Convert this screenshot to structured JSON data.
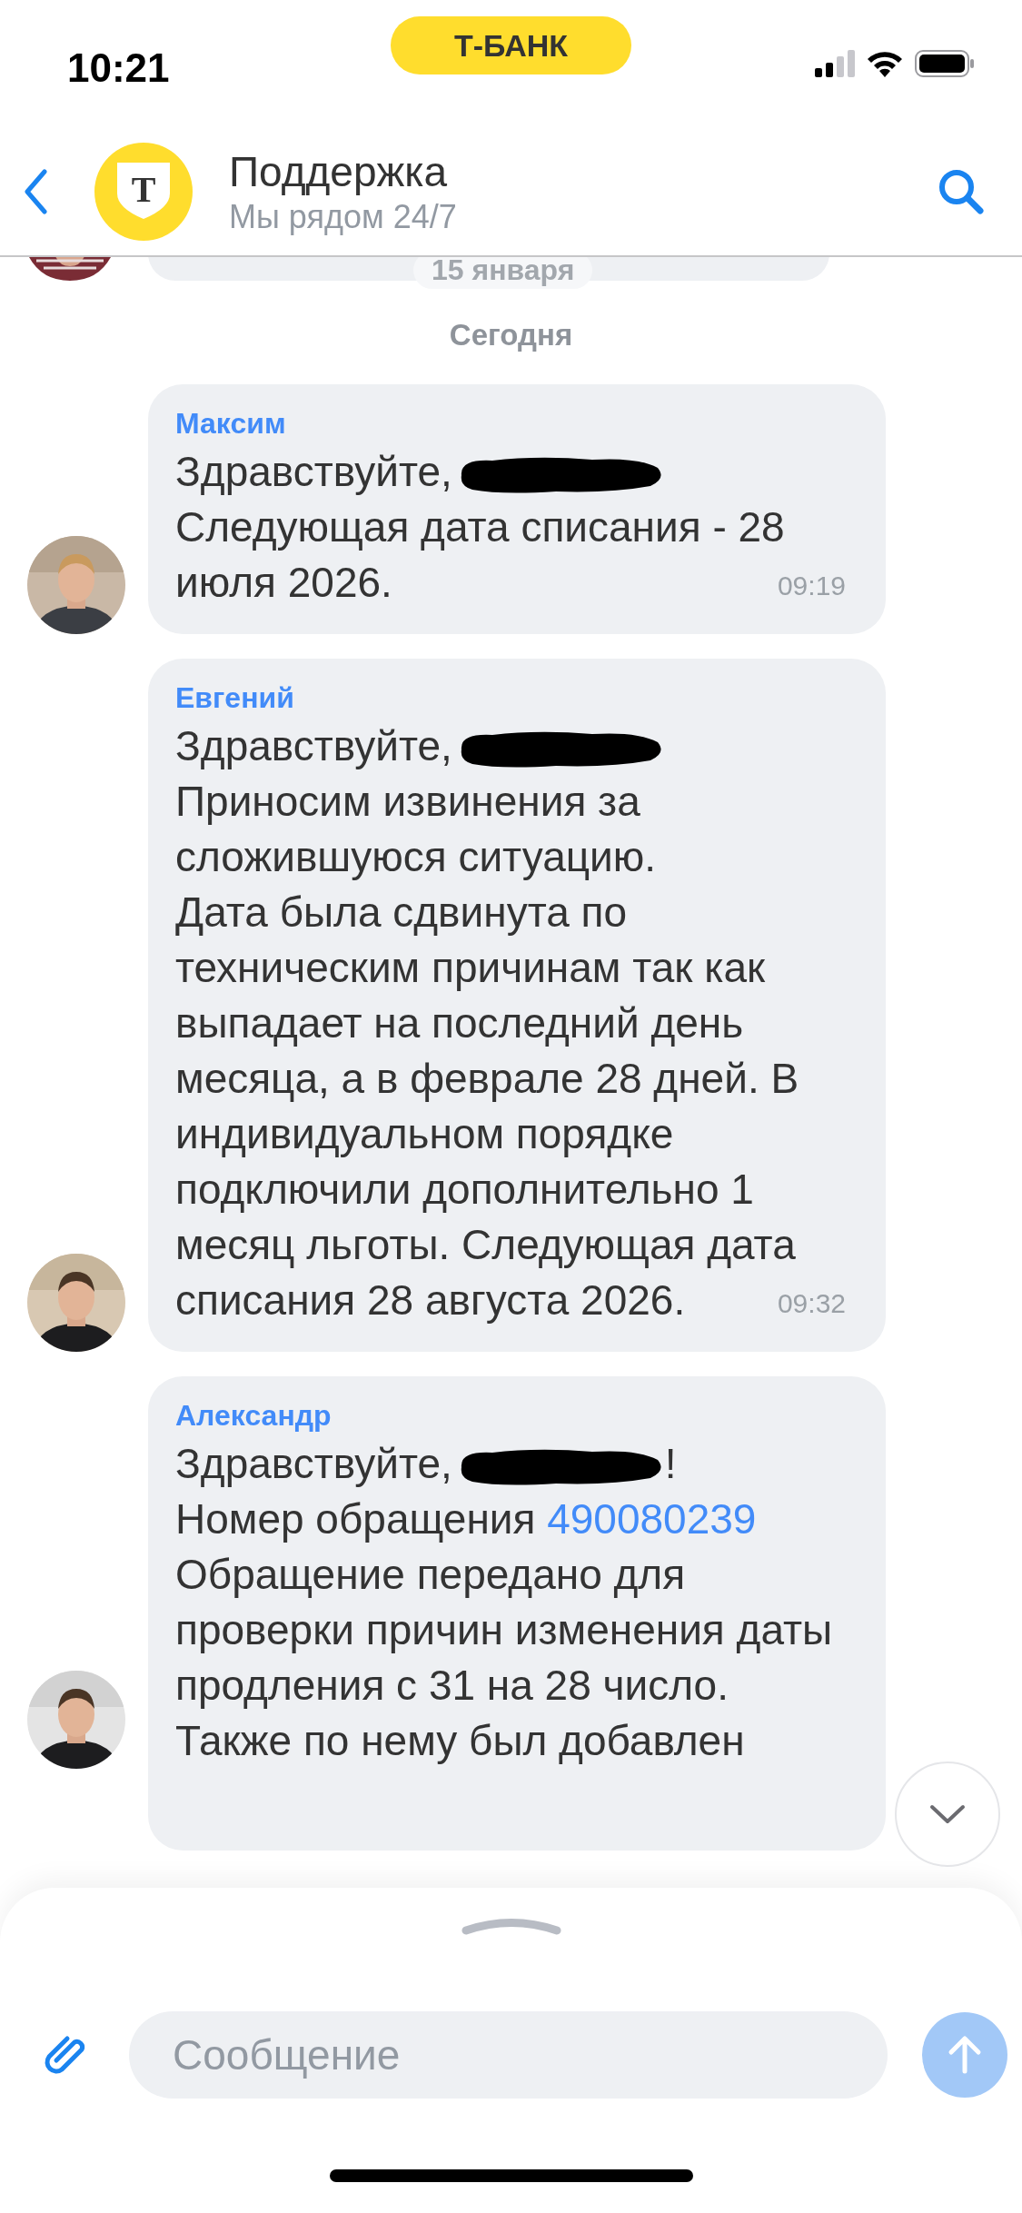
{
  "status_bar": {
    "time": "10:21",
    "brand_pill": "Т-БАНК"
  },
  "header": {
    "logo_letter": "Т",
    "title": "Поддержка",
    "subtitle": "Мы рядом 24/7"
  },
  "previous": {
    "date_chip": "15 января"
  },
  "day_separator": "Сегодня",
  "messages": [
    {
      "author": "Максим",
      "time": "09:19",
      "paragraphs": [
        [
          {
            "kind": "text",
            "text": "Здравствуйте,"
          },
          {
            "kind": "redacted"
          }
        ],
        [
          {
            "kind": "text",
            "text": "Следующая дата списания - 28 июля 2026."
          }
        ]
      ]
    },
    {
      "author": "Евгений",
      "time": "09:32",
      "paragraphs": [
        [
          {
            "kind": "text",
            "text": "Здравствуйте,"
          },
          {
            "kind": "redacted"
          }
        ],
        [
          {
            "kind": "text",
            "text": "Приносим извинения за сложившуюся ситуацию."
          }
        ],
        [
          {
            "kind": "text",
            "text": "Дата была сдвинута по техническим причинам так как выпадает на последний день месяца, а в феврале 28 дней. В индивидуальном порядке подключили дополнительно 1 месяц льготы. Следующая дата списания 28 августа 2026."
          }
        ]
      ]
    },
    {
      "author": "Александр",
      "paragraphs": [
        [
          {
            "kind": "text",
            "text": "Здравствуйте,"
          },
          {
            "kind": "redacted"
          },
          {
            "kind": "text",
            "text": "!"
          }
        ],
        [
          {
            "kind": "text",
            "text": "Номер обращения "
          },
          {
            "kind": "link",
            "text": "490080239"
          }
        ],
        [
          {
            "kind": "text",
            "text": "Обращение передано для проверки причин изменения даты продления с 31 на 28 число."
          }
        ],
        [
          {
            "kind": "text",
            "text": "Также по нему был добавлен"
          }
        ]
      ]
    }
  ],
  "composer": {
    "placeholder": "Сообщение",
    "send_disabled": true
  }
}
